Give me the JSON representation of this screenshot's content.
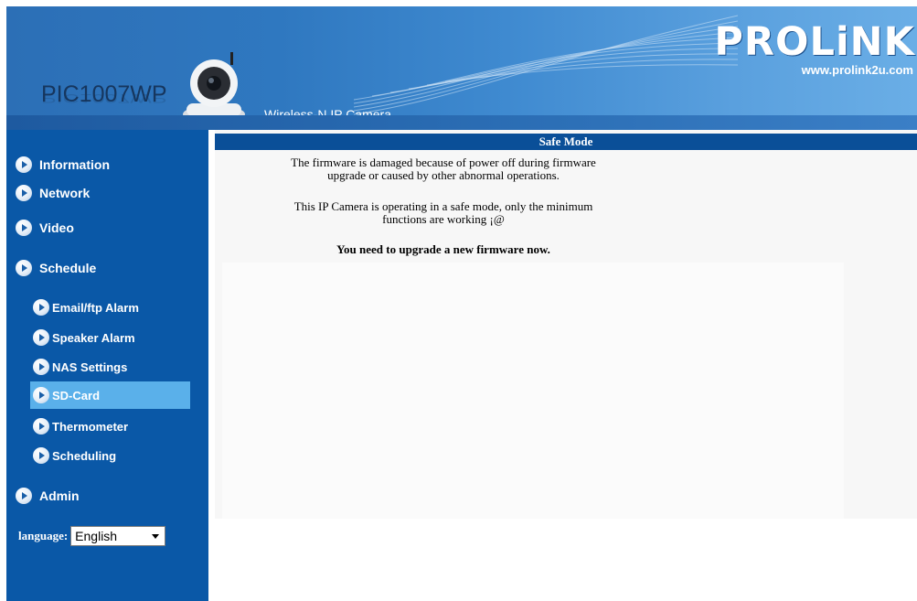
{
  "header": {
    "model": "PIC1007WP",
    "tagline": "Wireless-N  IP  Camera",
    "brand": "PROLiNK",
    "brand_url": "www.prolink2u.com"
  },
  "sidebar": {
    "main_items": [
      {
        "label": "Information"
      },
      {
        "label": "Network"
      },
      {
        "label": "Video"
      },
      {
        "label": "Schedule"
      }
    ],
    "sub_items": [
      {
        "label": "Email/ftp Alarm"
      },
      {
        "label": "Speaker Alarm"
      },
      {
        "label": "NAS Settings"
      },
      {
        "label": "SD-Card",
        "selected": true
      },
      {
        "label": "Thermometer"
      },
      {
        "label": "Scheduling"
      }
    ],
    "admin": {
      "label": "Admin"
    },
    "language": {
      "label": "language:",
      "value": "English"
    }
  },
  "content": {
    "title": "Safe Mode",
    "message_1_line1": "The firmware is damaged because of power off during firmware",
    "message_1_line2": "upgrade or caused by other abnormal operations.",
    "message_2_line1": "This IP Camera is operating in a safe mode, only the minimum",
    "message_2_line2": "functions are working ¡@",
    "message_3": "You need to upgrade a new firmware now."
  },
  "colors": {
    "sidebar": "#0a58a7",
    "selected": "#5ab0ea",
    "title_bar": "#0a4f98"
  }
}
